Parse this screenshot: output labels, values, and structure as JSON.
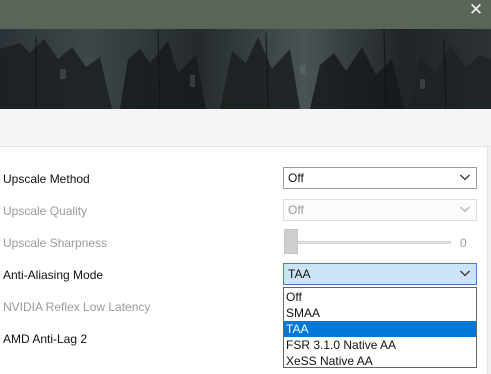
{
  "window": {
    "close_glyph": "✕"
  },
  "settings": {
    "upscale_method": {
      "label": "Upscale Method",
      "value": "Off"
    },
    "upscale_quality": {
      "label": "Upscale Quality",
      "value": "Off"
    },
    "upscale_sharpness": {
      "label": "Upscale Sharpness",
      "value": "0",
      "level": 0
    },
    "anti_aliasing_mode": {
      "label": "Anti-Aliasing Mode",
      "value": "TAA",
      "options": [
        "Off",
        "SMAA",
        "TAA",
        "FSR 3.1.0 Native AA",
        "XeSS Native AA"
      ],
      "selected_index": 2
    },
    "nvidia_reflex": {
      "label": "NVIDIA Reflex Low Latency"
    },
    "amd_anti_lag": {
      "label": "AMD Anti-Lag 2"
    }
  },
  "colors": {
    "accent": "#0078d7",
    "focus_fill": "#cce4f7",
    "disabled_text": "#9a9a9a",
    "titlebar": "#5b6458"
  },
  "icons": {
    "close": "close-icon",
    "chevron": "chevron-down-icon"
  }
}
